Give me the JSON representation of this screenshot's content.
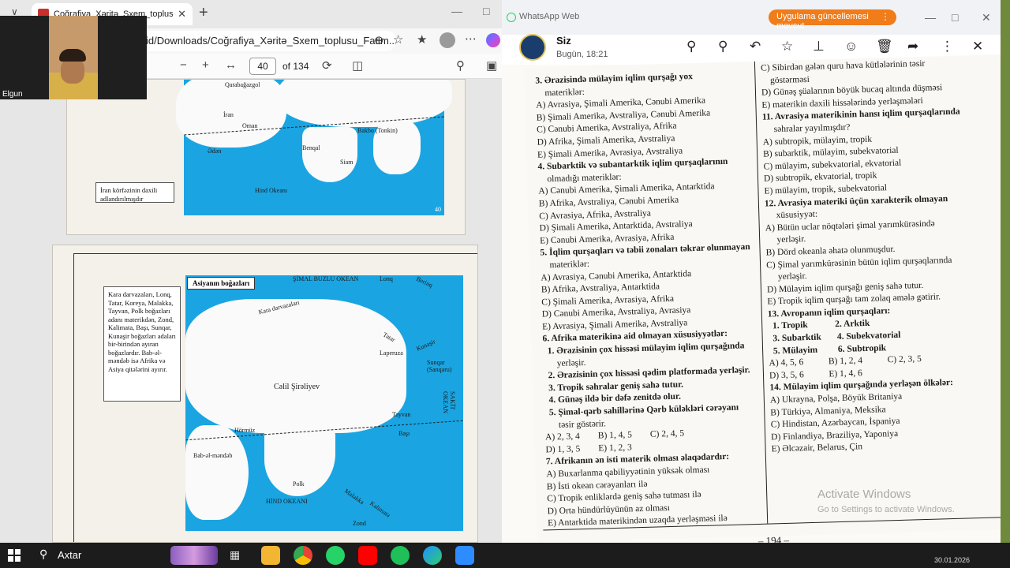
{
  "edge": {
    "tab_title": "Coğrafiya_Xəritə_Sxem_toplusu_Fa",
    "url": "id/Downloads/Coğrafiya_Xəritə_Sxem_toplusu_Fatim...",
    "page_current": "40",
    "page_total": "of 134",
    "webcam_name": "Elgun"
  },
  "map1": {
    "labels": [
      "Qarabağazgol",
      "İran",
      "Oman",
      "Ədən",
      "Benqal",
      "Bakbo (Tonkin)",
      "Siam",
      "Hind Okeanı",
      "40"
    ],
    "note": "İran körfəzinin daxili adlandırılmışdır"
  },
  "map2": {
    "title": "Asiyanın boğazları",
    "labels": [
      "ŞİMAL BUZLU OKEAN",
      "Lonq",
      "Berinq",
      "Kara darvazaları",
      "Tatar",
      "Laperuza",
      "Kunaşir",
      "Sunqar (Sanqaru)",
      "Cəlil Şirəliyev",
      "Tayvan",
      "Başı",
      "SAKİT OKEAN",
      "Hörmüz",
      "Bab-əl-məndəb",
      "Polk",
      "Malakka",
      "Kalimata",
      "HİND OKEANI",
      "Zond"
    ],
    "note": "Kara darvazaları, Lonq, Tatar, Koreya, Malakka, Tayvan, Polk boğazları adanı materikdən, Zond, Kalimata, Başı, Sunqar, Kunaşir boğazları adaları bir-birindən ayıran boğazlardır. Bab-əl-məndəb isə Afrika və Asiya qitələrini ayırır."
  },
  "whatsapp": {
    "window_title": "WhatsApp Web",
    "update_badge": "Uygulama güncellemesi mevcut",
    "contact_name": "Siz",
    "contact_time": "Bugün, 18:21"
  },
  "book": {
    "left_col": [
      "3. Ərazisində mülayim iqlim qurşağı yox",
      "    materiklər:",
      "A) Avrasiya, Şimali Amerika, Cənubi Amerika",
      "B) Şimali Amerika, Avstraliya, Cənubi Amerika",
      "C) Cənubi Amerika, Avstraliya, Afrika",
      "D) Afrika, Şimali Amerika, Avstraliya",
      "E) Şimali Amerika, Avrasiya, Avstraliya",
      "4. Subarktik və subantarktik iqlim qurşaqlarının",
      "    olmadığı materiklər:",
      "A) Cənubi Amerika, Şimali Amerika, Antarktida",
      "B) Afrika, Avstraliya, Cənubi Amerika",
      "C) Avrasiya, Afrika, Avstraliya",
      "D) Şimali Amerika, Antarktida, Avstraliya",
      "E) Cənubi Amerika, Avrasiya, Afrika",
      "5. İqlim qurşaqları və təbii zonaları təkrar olunmayan",
      "    materiklər:",
      "A) Avrasiya, Cənubi Amerika, Antarktida",
      "B) Afrika, Avstraliya, Antarktida",
      "C) Şimali Amerika, Avrasiya, Afrika",
      "D) Cənubi Amerika, Avstraliya, Avrasiya",
      "E) Avrasiya, Şimali Amerika, Avstraliya",
      "6. Afrika materikinə aid olmayan xüsusiyyətlər:",
      "  1. Ərazisinin çox hissəsi mülayim iqlim qurşağında",
      "      yerləşir.",
      "  2. Ərazisinin çox hissəsi qədim platformada yerləşir.",
      "  3. Tropik səhralar geniş sahə tutur.",
      "  4. Günəş ildə bir dəfə zenitdə olur.",
      "  5. Şimal-qərb sahillərinə Qərb küləkləri cərəyanı",
      "      təsir göstərir.",
      "A) 2, 3, 4        B) 1, 4, 5        C) 2, 4, 5",
      "D) 1, 3, 5        E) 1, 2, 3",
      "7. Afrikanın ən isti materik olması əlaqədardır:",
      "A) Buxarlanma qabiliyyətinin yüksək olması",
      "B) İsti okean cərəyanları ilə",
      "C) Tropik enliklərdə geniş sahə tutması ilə",
      "D) Orta hündürlüyünün az olması",
      "E) Antarktida materikindən uzaqda yerləşməsi ilə"
    ],
    "right_col": [
      "C) Sibirdən gələn quru hava kütlələrinin təsir",
      "    göstərməsi",
      "D) Günəş şüalarının böyük bucaq altında düşməsi",
      "E) materikin daxili hissələrində yerləşmələri",
      "11. Avrasiya materikinin hansı iqlim qurşaqlarında",
      "     səhralar yayılmışdır?",
      "A) subtropik, mülayim, tropik",
      "B) subarktik, mülayim, subekvatorial",
      "C) mülayim, subekvatorial, ekvatorial",
      "D) subtropik, ekvatorial, tropik",
      "E) mülayim, tropik, subekvatorial",
      "12. Avrasiya materiki üçün xarakterik olmayan",
      "     xüsusiyyət:",
      "A) Bütün uclar nöqtələri şimal yarımkürəsində",
      "     yerləşir.",
      "B) Dörd okeanla əhatə olunmuşdur.",
      "C) Şimal yarımkürəsinin bütün iqlim qurşaqlarında",
      "     yerləşir.",
      "D) Mülayim iqlim qurşağı geniş sahə tutur.",
      "E) Tropik iqlim qurşağı tam zolaq əmələ gətirir.",
      "13. Avropanın iqlim qurşaqları:",
      "  1. Tropik            2. Arktik",
      "  3. Subarktik       4. Subekvatorial",
      "  5. Mülayim         6. Subtropik",
      "A) 4, 5, 6           B) 1, 2, 4           C) 2, 3, 5",
      "D) 3, 5, 6           E) 1, 4, 6",
      "14. Mülayim iqlim qurşağında yerləşən ölkələr:",
      "A) Ukrayna, Polşa, Böyük Britaniya",
      "B) Türkiyə, Almaniya, Meksika",
      "C) Hindistan, Azərbaycan, İspaniya",
      "D) Finlandiya, Braziliya, Yaponiya",
      "E) Əlcəzair, Belarus, Çin"
    ],
    "page_number": "– 194 –"
  },
  "watermark": {
    "line1": "Activate Windows",
    "line2": "Go to Settings to activate Windows."
  },
  "taskbar": {
    "search_label": "Axtar",
    "date": "30.01.2026"
  }
}
